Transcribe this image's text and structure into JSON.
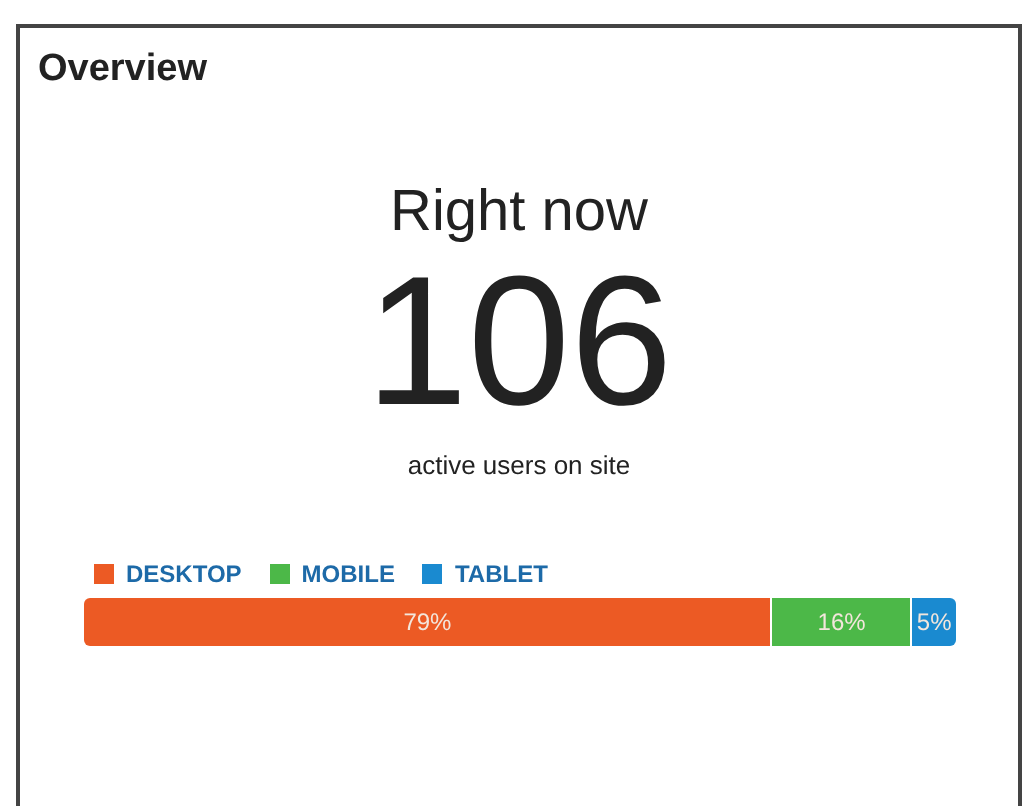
{
  "panel": {
    "title": "Overview"
  },
  "realtime": {
    "heading": "Right now",
    "count": "106",
    "caption": "active users on site"
  },
  "devices": [
    {
      "label": "DESKTOP",
      "color": "#ec5a24",
      "reading": "79%"
    },
    {
      "label": "MOBILE",
      "color": "#4cb848",
      "reading": "16%"
    },
    {
      "label": "TABLET",
      "color": "#1a8ad0",
      "reading": "5%"
    }
  ]
}
